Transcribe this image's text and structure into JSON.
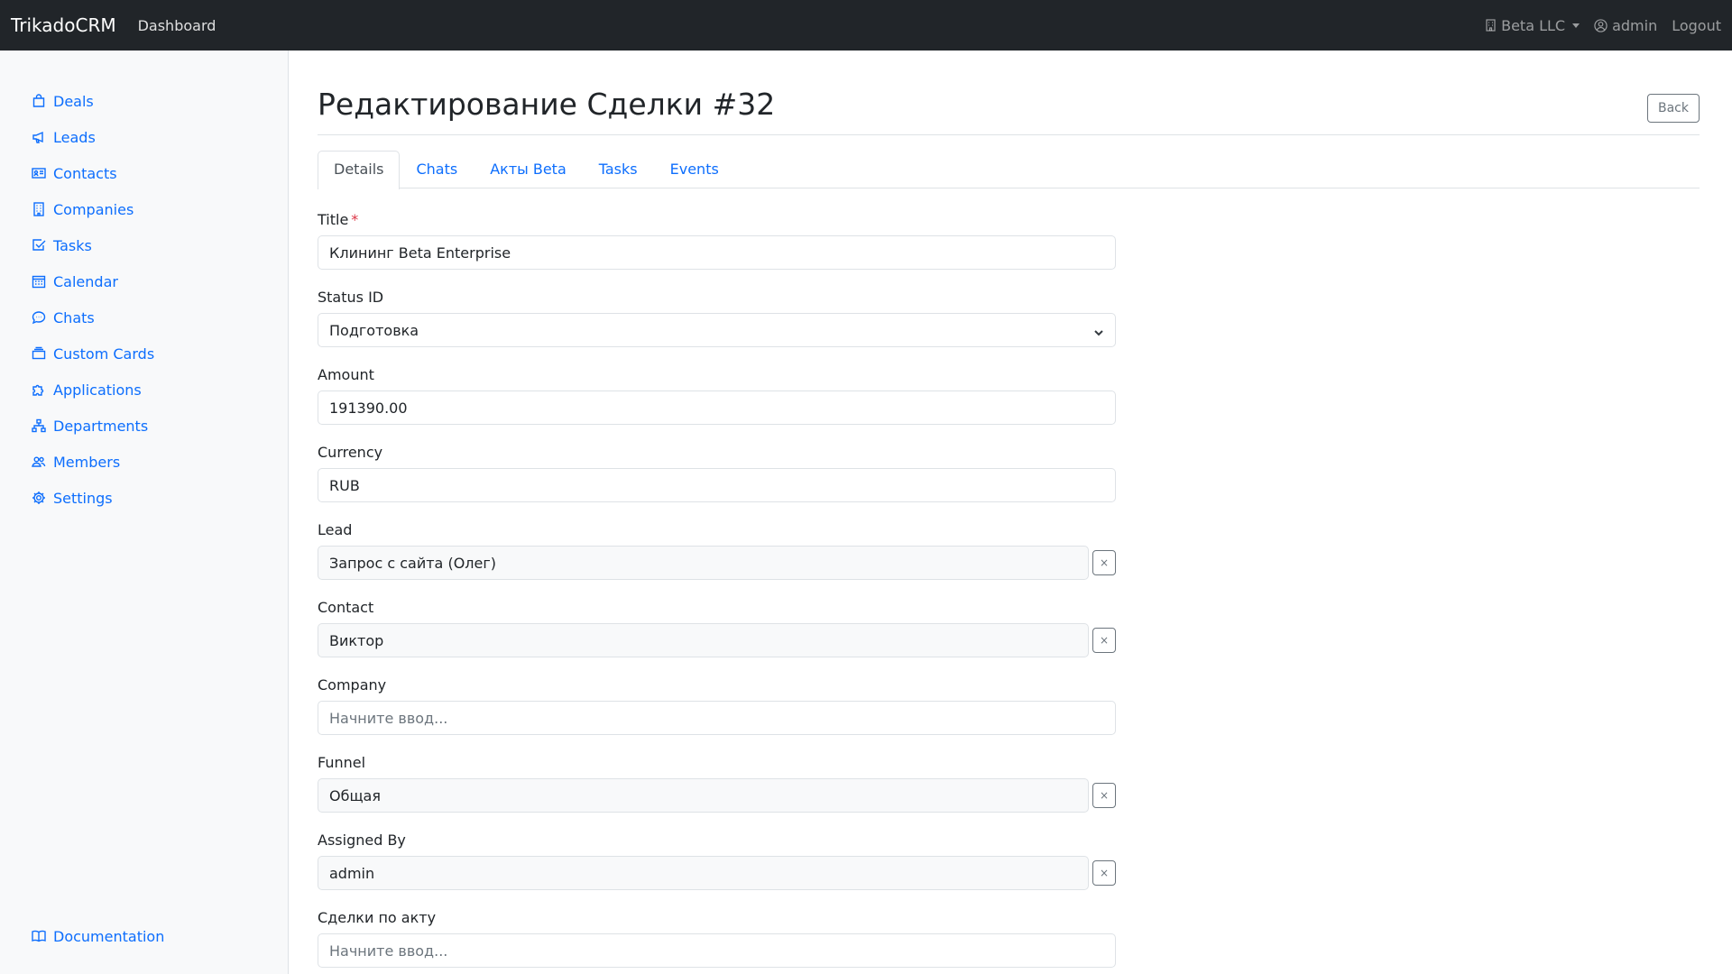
{
  "navbar": {
    "brand": "TrikadoCRM",
    "dashboard": "Dashboard",
    "company": "Beta LLC",
    "user": "admin",
    "logout": "Logout"
  },
  "sidebar": {
    "items": [
      {
        "label": "Deals",
        "icon": "bag-icon"
      },
      {
        "label": "Leads",
        "icon": "megaphone-icon"
      },
      {
        "label": "Contacts",
        "icon": "person-card-icon"
      },
      {
        "label": "Companies",
        "icon": "building-icon"
      },
      {
        "label": "Tasks",
        "icon": "check-square-icon"
      },
      {
        "label": "Calendar",
        "icon": "calendar-icon"
      },
      {
        "label": "Chats",
        "icon": "chat-icon"
      },
      {
        "label": "Custom Cards",
        "icon": "cards-icon"
      },
      {
        "label": "Applications",
        "icon": "puzzle-icon"
      },
      {
        "label": "Departments",
        "icon": "diagram-icon"
      },
      {
        "label": "Members",
        "icon": "people-icon"
      },
      {
        "label": "Settings",
        "icon": "gear-icon"
      }
    ],
    "footer": {
      "label": "Documentation",
      "icon": "book-icon"
    }
  },
  "page": {
    "title": "Редактирование Сделки #32",
    "back": "Back"
  },
  "tabs": [
    "Details",
    "Chats",
    "Акты Beta",
    "Tasks",
    "Events"
  ],
  "form": {
    "title": {
      "label": "Title",
      "required": "*",
      "value": "Клининг Beta Enterprise"
    },
    "status": {
      "label": "Status ID",
      "value": "Подготовка"
    },
    "amount": {
      "label": "Amount",
      "value": "191390.00"
    },
    "currency": {
      "label": "Currency",
      "value": "RUB"
    },
    "lead": {
      "label": "Lead",
      "value": "Запрос с сайта (Олег)"
    },
    "contact": {
      "label": "Contact",
      "value": "Виктор"
    },
    "company": {
      "label": "Company",
      "placeholder": "Начните ввод..."
    },
    "funnel": {
      "label": "Funnel",
      "value": "Общая"
    },
    "assigned": {
      "label": "Assigned By",
      "value": "admin"
    },
    "act_deals": {
      "label": "Сделки по акту",
      "placeholder": "Начните ввод..."
    },
    "clear": "×"
  }
}
